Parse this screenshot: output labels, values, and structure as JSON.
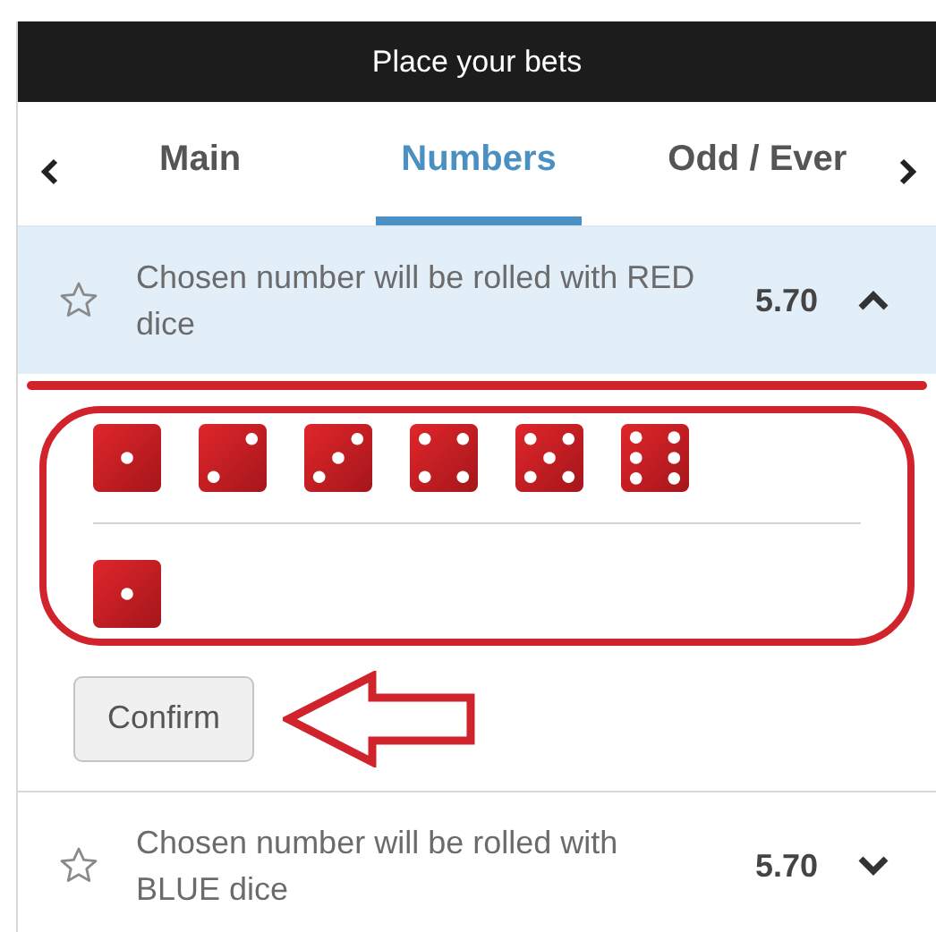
{
  "header": {
    "title": "Place your bets"
  },
  "tabs": [
    {
      "label": "Main",
      "selected": false
    },
    {
      "label": "Numbers",
      "selected": true
    },
    {
      "label": "Odd / Ever",
      "selected": false
    }
  ],
  "markets": [
    {
      "text": "Chosen number will be rolled with RED dice",
      "odds": "5.70",
      "expanded": true,
      "favorite": false,
      "dice_options": [
        {
          "kind": "one"
        },
        {
          "kind": "two"
        },
        {
          "kind": "three"
        },
        {
          "kind": "four"
        },
        {
          "kind": "five"
        },
        {
          "kind": "six"
        }
      ],
      "chosen": [
        {
          "kind": "one"
        }
      ],
      "confirm": "Confirm"
    },
    {
      "text": "Chosen number will be rolled with BLUE dice",
      "odds": "5.70",
      "expanded": false,
      "favorite": false
    }
  ]
}
